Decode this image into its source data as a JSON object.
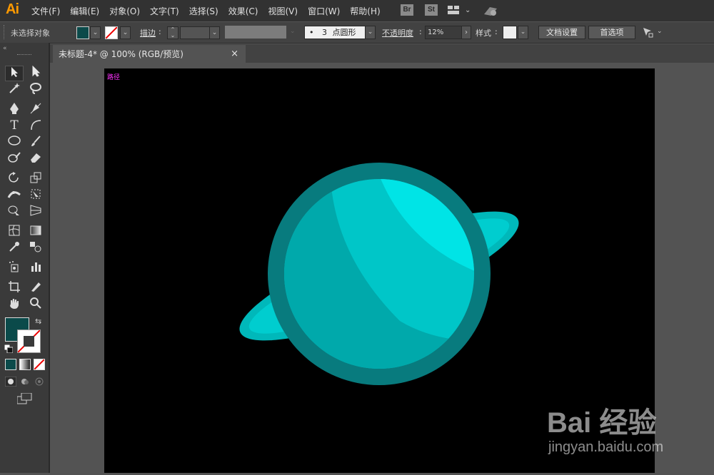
{
  "app": {
    "logo": "Ai"
  },
  "menu": [
    "文件(F)",
    "编辑(E)",
    "对象(O)",
    "文字(T)",
    "选择(S)",
    "效果(C)",
    "视图(V)",
    "窗口(W)",
    "帮助(H)"
  ],
  "menu_buttons": {
    "br": "Br",
    "st": "St"
  },
  "control": {
    "selection": "未选择对象",
    "stroke_label": "描边",
    "brush_size": "3",
    "brush_name": "点圆形",
    "opacity_label": "不透明度",
    "opacity_value": "12%",
    "style_label": "样式",
    "doc_setup": "文档设置",
    "preferences": "首选项",
    "fill_color": "#0b4a4a"
  },
  "document": {
    "tab_title": "未标题-4* @ 100% (RGB/预览)",
    "close": "×"
  },
  "canvas": {
    "path_label": "路径",
    "planet_colors": {
      "rim": "#087b7e",
      "body": "#00c6c8",
      "light": "#00e4e6",
      "shade": "#00a9ab",
      "ring": "#00b8ba",
      "ring_inner": "#00cdcf"
    }
  },
  "watermark": {
    "brand": "Bai 经验",
    "url": "jingyan.baidu.com"
  }
}
